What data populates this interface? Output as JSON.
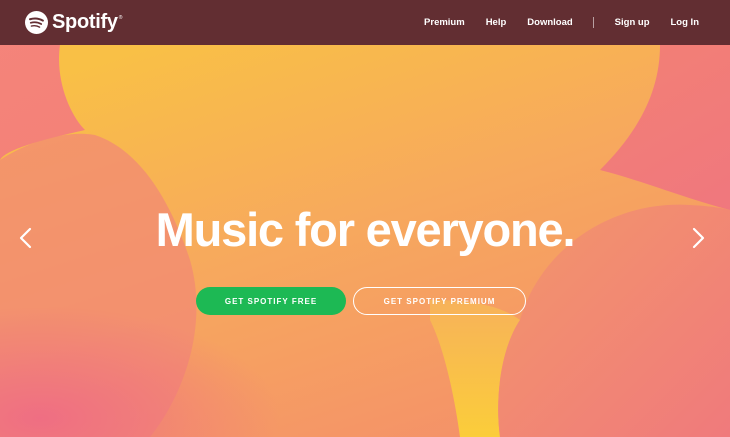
{
  "header": {
    "logo_text": "Spotify",
    "logo_trademark": "®",
    "nav": {
      "premium": "Premium",
      "help": "Help",
      "download": "Download",
      "signup": "Sign up",
      "login": "Log In"
    }
  },
  "hero": {
    "headline": "Music for everyone.",
    "primary_cta": "GET SPOTIFY FREE",
    "secondary_cta": "GET SPOTIFY PREMIUM"
  },
  "carousel": {
    "prev_icon": "chevron-left-icon",
    "next_icon": "chevron-right-icon"
  },
  "colors": {
    "header_bg": "#622e32",
    "hero_pink": "#f07a78",
    "hero_orange": "#f7a85c",
    "hero_yellow": "#f9c443",
    "cta_green": "#1db954",
    "text": "#ffffff"
  }
}
